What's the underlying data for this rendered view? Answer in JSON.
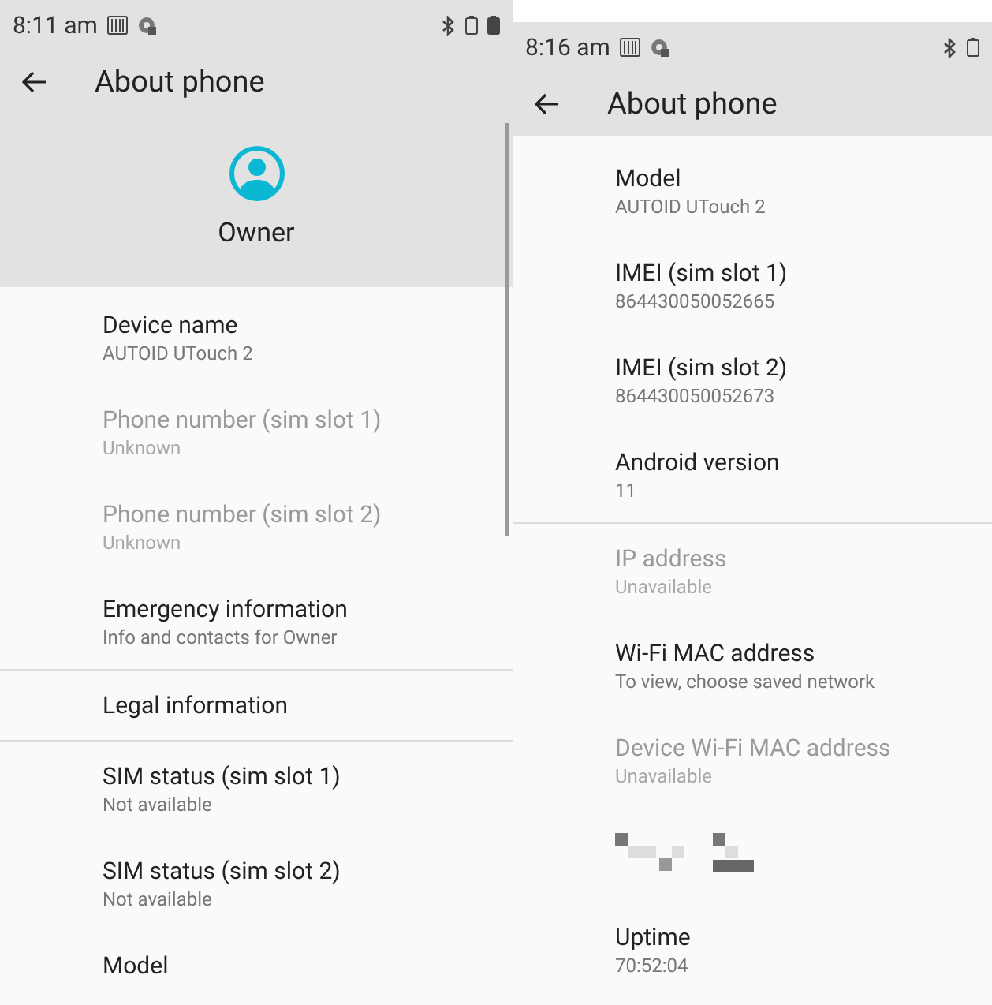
{
  "screens": [
    {
      "status_bar": {
        "time": "8:11 am"
      },
      "toolbar": {
        "title": "About phone"
      },
      "header": {
        "name": "Owner"
      },
      "sections": [
        [
          {
            "kind": "item",
            "title": "Device name",
            "summary": "AUTOID UTouch 2",
            "disabled": false
          },
          {
            "kind": "item",
            "title": "Phone number (sim slot 1)",
            "summary": "Unknown",
            "disabled": true
          },
          {
            "kind": "item",
            "title": "Phone number (sim slot 2)",
            "summary": "Unknown",
            "disabled": true
          },
          {
            "kind": "item",
            "title": "Emergency information",
            "summary": "Info and contacts for Owner",
            "disabled": false
          }
        ],
        [
          {
            "kind": "item",
            "title": "Legal information",
            "disabled": false
          }
        ],
        [
          {
            "kind": "item",
            "title": "SIM status (sim slot 1)",
            "summary": "Not available",
            "disabled": false
          },
          {
            "kind": "item",
            "title": "SIM status (sim slot 2)",
            "summary": "Not available",
            "disabled": false
          },
          {
            "kind": "item",
            "title": "Model",
            "disabled": false
          }
        ]
      ]
    },
    {
      "status_bar": {
        "time": "8:16 am"
      },
      "toolbar": {
        "title": "About phone"
      },
      "sections": [
        [
          {
            "kind": "item",
            "title": "Model",
            "summary": "AUTOID UTouch 2",
            "disabled": false
          },
          {
            "kind": "item",
            "title": "IMEI (sim slot 1)",
            "summary": "864430050052665",
            "disabled": false
          },
          {
            "kind": "item",
            "title": "IMEI (sim slot 2)",
            "summary": "864430050052673",
            "disabled": false
          },
          {
            "kind": "item",
            "title": "Android version",
            "summary": "11",
            "disabled": false
          }
        ],
        [
          {
            "kind": "item",
            "title": "IP address",
            "summary": "Unavailable",
            "disabled": true
          },
          {
            "kind": "item",
            "title": "Wi-Fi MAC address",
            "summary": "To view, choose saved network",
            "disabled": false
          },
          {
            "kind": "item",
            "title": "Device Wi-Fi MAC address",
            "summary": "Unavailable",
            "disabled": true
          },
          {
            "kind": "redacted"
          },
          {
            "kind": "item",
            "title": "Uptime",
            "summary": "70:52:04",
            "disabled": false
          }
        ]
      ]
    }
  ]
}
